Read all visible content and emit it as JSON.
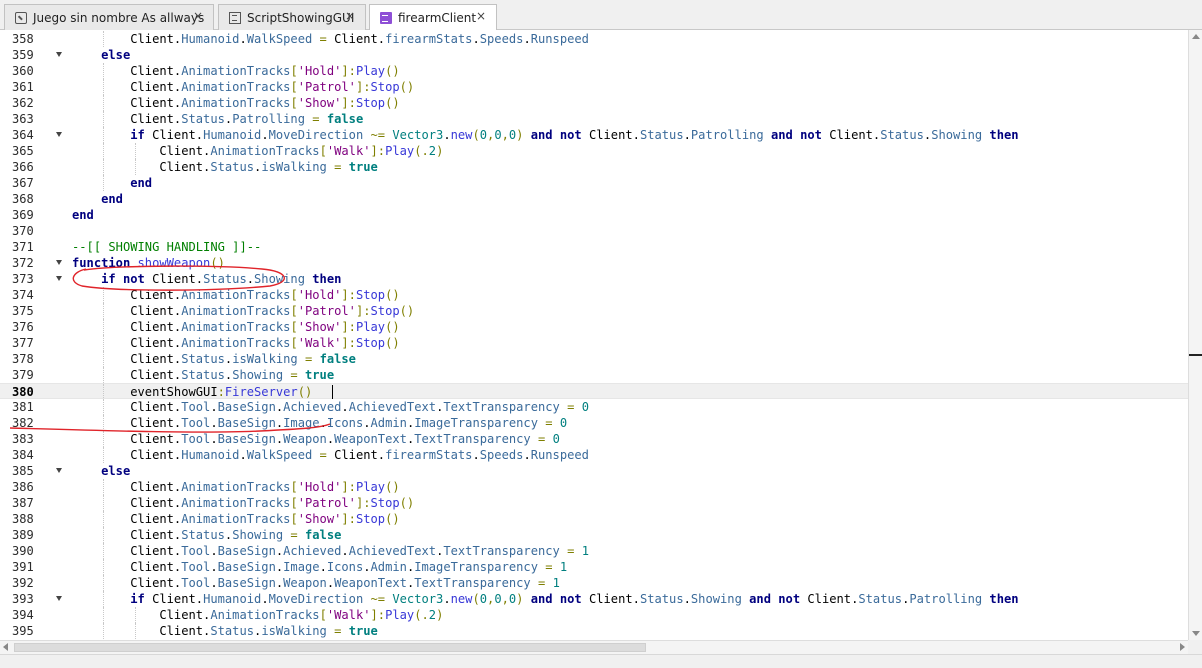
{
  "tabs": [
    {
      "label": "Juego sin nombre As allways",
      "close": "×",
      "icon": "place-icon",
      "active": false
    },
    {
      "label": "ScriptShowingGUI",
      "close": "×",
      "icon": "script-icon",
      "active": false
    },
    {
      "label": "firearmClient",
      "close": "×",
      "icon": "local-script-icon",
      "active": true
    }
  ],
  "current_line": "380",
  "lines": [
    {
      "n": "358",
      "fold": false,
      "t": [
        [
          "df",
          "        Client."
        ],
        [
          "pr",
          "Humanoid"
        ],
        [
          "df",
          "."
        ],
        [
          "pr",
          "WalkSpeed"
        ],
        [
          "op",
          " = "
        ],
        [
          "df",
          "Client."
        ],
        [
          "pr",
          "firearmStats"
        ],
        [
          "df",
          "."
        ],
        [
          "pr",
          "Speeds"
        ],
        [
          "df",
          "."
        ],
        [
          "pr",
          "Runspeed"
        ]
      ]
    },
    {
      "n": "359",
      "fold": true,
      "t": [
        [
          "kw",
          "    else"
        ]
      ]
    },
    {
      "n": "360",
      "fold": false,
      "t": [
        [
          "df",
          "        Client."
        ],
        [
          "pr",
          "AnimationTracks"
        ],
        [
          "op",
          "["
        ],
        [
          "st",
          "'Hold'"
        ],
        [
          "op",
          "]:"
        ],
        [
          "fn",
          "Play"
        ],
        [
          "op",
          "()"
        ]
      ]
    },
    {
      "n": "361",
      "fold": false,
      "t": [
        [
          "df",
          "        Client."
        ],
        [
          "pr",
          "AnimationTracks"
        ],
        [
          "op",
          "["
        ],
        [
          "st",
          "'Patrol'"
        ],
        [
          "op",
          "]:"
        ],
        [
          "fn",
          "Stop"
        ],
        [
          "op",
          "()"
        ]
      ]
    },
    {
      "n": "362",
      "fold": false,
      "t": [
        [
          "df",
          "        Client."
        ],
        [
          "pr",
          "AnimationTracks"
        ],
        [
          "op",
          "["
        ],
        [
          "st",
          "'Show'"
        ],
        [
          "op",
          "]:"
        ],
        [
          "fn",
          "Stop"
        ],
        [
          "op",
          "()"
        ]
      ]
    },
    {
      "n": "363",
      "fold": false,
      "t": [
        [
          "df",
          "        Client."
        ],
        [
          "pr",
          "Status"
        ],
        [
          "df",
          "."
        ],
        [
          "pr",
          "Patrolling"
        ],
        [
          "op",
          " = "
        ],
        [
          "bo",
          "false"
        ]
      ]
    },
    {
      "n": "364",
      "fold": true,
      "t": [
        [
          "kw",
          "        if "
        ],
        [
          "df",
          "Client."
        ],
        [
          "pr",
          "Humanoid"
        ],
        [
          "df",
          "."
        ],
        [
          "pr",
          "MoveDirection"
        ],
        [
          "op",
          " ~= "
        ],
        [
          "gl",
          "Vector3"
        ],
        [
          "df",
          "."
        ],
        [
          "fn",
          "new"
        ],
        [
          "op",
          "("
        ],
        [
          "nm",
          "0"
        ],
        [
          "op",
          ","
        ],
        [
          "nm",
          "0"
        ],
        [
          "op",
          ","
        ],
        [
          "nm",
          "0"
        ],
        [
          "op",
          ") "
        ],
        [
          "kw",
          "and not "
        ],
        [
          "df",
          "Client."
        ],
        [
          "pr",
          "Status"
        ],
        [
          "df",
          "."
        ],
        [
          "pr",
          "Patrolling"
        ],
        [
          "kw",
          " and not "
        ],
        [
          "df",
          "Client."
        ],
        [
          "pr",
          "Status"
        ],
        [
          "df",
          "."
        ],
        [
          "pr",
          "Showing"
        ],
        [
          "kw",
          " then"
        ]
      ]
    },
    {
      "n": "365",
      "fold": false,
      "t": [
        [
          "df",
          "            Client."
        ],
        [
          "pr",
          "AnimationTracks"
        ],
        [
          "op",
          "["
        ],
        [
          "st",
          "'Walk'"
        ],
        [
          "op",
          "]:"
        ],
        [
          "fn",
          "Play"
        ],
        [
          "op",
          "(."
        ],
        [
          "nm",
          "2"
        ],
        [
          "op",
          ")"
        ]
      ]
    },
    {
      "n": "366",
      "fold": false,
      "t": [
        [
          "df",
          "            Client."
        ],
        [
          "pr",
          "Status"
        ],
        [
          "df",
          "."
        ],
        [
          "pr",
          "isWalking"
        ],
        [
          "op",
          " = "
        ],
        [
          "bo",
          "true"
        ]
      ]
    },
    {
      "n": "367",
      "fold": false,
      "t": [
        [
          "kw",
          "        end"
        ]
      ]
    },
    {
      "n": "368",
      "fold": false,
      "t": [
        [
          "kw",
          "    end"
        ]
      ]
    },
    {
      "n": "369",
      "fold": false,
      "t": [
        [
          "kw",
          "end"
        ]
      ]
    },
    {
      "n": "370",
      "fold": false,
      "t": []
    },
    {
      "n": "371",
      "fold": false,
      "t": [
        [
          "cm",
          "--[[ SHOWING HANDLING ]]--"
        ]
      ]
    },
    {
      "n": "372",
      "fold": true,
      "t": [
        [
          "kw",
          "function "
        ],
        [
          "fn",
          "showWeapon"
        ],
        [
          "op",
          "()"
        ]
      ]
    },
    {
      "n": "373",
      "fold": true,
      "t": [
        [
          "kw",
          "    if not "
        ],
        [
          "df",
          "Client."
        ],
        [
          "pr",
          "Status"
        ],
        [
          "df",
          "."
        ],
        [
          "pr",
          "Showing"
        ],
        [
          "kw",
          " then"
        ]
      ]
    },
    {
      "n": "374",
      "fold": false,
      "t": [
        [
          "df",
          "        Client."
        ],
        [
          "pr",
          "AnimationTracks"
        ],
        [
          "op",
          "["
        ],
        [
          "st",
          "'Hold'"
        ],
        [
          "op",
          "]:"
        ],
        [
          "fn",
          "Stop"
        ],
        [
          "op",
          "()"
        ]
      ]
    },
    {
      "n": "375",
      "fold": false,
      "t": [
        [
          "df",
          "        Client."
        ],
        [
          "pr",
          "AnimationTracks"
        ],
        [
          "op",
          "["
        ],
        [
          "st",
          "'Patrol'"
        ],
        [
          "op",
          "]:"
        ],
        [
          "fn",
          "Stop"
        ],
        [
          "op",
          "()"
        ]
      ]
    },
    {
      "n": "376",
      "fold": false,
      "t": [
        [
          "df",
          "        Client."
        ],
        [
          "pr",
          "AnimationTracks"
        ],
        [
          "op",
          "["
        ],
        [
          "st",
          "'Show'"
        ],
        [
          "op",
          "]:"
        ],
        [
          "fn",
          "Play"
        ],
        [
          "op",
          "()"
        ]
      ]
    },
    {
      "n": "377",
      "fold": false,
      "t": [
        [
          "df",
          "        Client."
        ],
        [
          "pr",
          "AnimationTracks"
        ],
        [
          "op",
          "["
        ],
        [
          "st",
          "'Walk'"
        ],
        [
          "op",
          "]:"
        ],
        [
          "fn",
          "Stop"
        ],
        [
          "op",
          "()"
        ]
      ]
    },
    {
      "n": "378",
      "fold": false,
      "t": [
        [
          "df",
          "        Client."
        ],
        [
          "pr",
          "Status"
        ],
        [
          "df",
          "."
        ],
        [
          "pr",
          "isWalking"
        ],
        [
          "op",
          " = "
        ],
        [
          "bo",
          "false"
        ]
      ]
    },
    {
      "n": "379",
      "fold": false,
      "t": [
        [
          "df",
          "        Client."
        ],
        [
          "pr",
          "Status"
        ],
        [
          "df",
          "."
        ],
        [
          "pr",
          "Showing"
        ],
        [
          "op",
          " = "
        ],
        [
          "bo",
          "true"
        ]
      ]
    },
    {
      "n": "380",
      "fold": false,
      "t": [
        [
          "df",
          "        eventShowGUI"
        ],
        [
          "op",
          ":"
        ],
        [
          "fn",
          "FireServer"
        ],
        [
          "op",
          "()"
        ]
      ]
    },
    {
      "n": "381",
      "fold": false,
      "t": [
        [
          "df",
          "        Client."
        ],
        [
          "pr",
          "Tool"
        ],
        [
          "df",
          "."
        ],
        [
          "pr",
          "BaseSign"
        ],
        [
          "df",
          "."
        ],
        [
          "pr",
          "Achieved"
        ],
        [
          "df",
          "."
        ],
        [
          "pr",
          "AchievedText"
        ],
        [
          "df",
          "."
        ],
        [
          "pr",
          "TextTransparency"
        ],
        [
          "op",
          " = "
        ],
        [
          "nm",
          "0"
        ]
      ]
    },
    {
      "n": "382",
      "fold": false,
      "t": [
        [
          "df",
          "        Client."
        ],
        [
          "pr",
          "Tool"
        ],
        [
          "df",
          "."
        ],
        [
          "pr",
          "BaseSign"
        ],
        [
          "df",
          "."
        ],
        [
          "pr",
          "Image"
        ],
        [
          "df",
          "."
        ],
        [
          "pr",
          "Icons"
        ],
        [
          "df",
          "."
        ],
        [
          "pr",
          "Admin"
        ],
        [
          "df",
          "."
        ],
        [
          "pr",
          "ImageTransparency"
        ],
        [
          "op",
          " = "
        ],
        [
          "nm",
          "0"
        ]
      ]
    },
    {
      "n": "383",
      "fold": false,
      "t": [
        [
          "df",
          "        Client."
        ],
        [
          "pr",
          "Tool"
        ],
        [
          "df",
          "."
        ],
        [
          "pr",
          "BaseSign"
        ],
        [
          "df",
          "."
        ],
        [
          "pr",
          "Weapon"
        ],
        [
          "df",
          "."
        ],
        [
          "pr",
          "WeaponText"
        ],
        [
          "df",
          "."
        ],
        [
          "pr",
          "TextTransparency"
        ],
        [
          "op",
          " = "
        ],
        [
          "nm",
          "0"
        ]
      ]
    },
    {
      "n": "384",
      "fold": false,
      "t": [
        [
          "df",
          "        Client."
        ],
        [
          "pr",
          "Humanoid"
        ],
        [
          "df",
          "."
        ],
        [
          "pr",
          "WalkSpeed"
        ],
        [
          "op",
          " = "
        ],
        [
          "df",
          "Client."
        ],
        [
          "pr",
          "firearmStats"
        ],
        [
          "df",
          "."
        ],
        [
          "pr",
          "Speeds"
        ],
        [
          "df",
          "."
        ],
        [
          "pr",
          "Runspeed"
        ]
      ]
    },
    {
      "n": "385",
      "fold": true,
      "t": [
        [
          "kw",
          "    else"
        ]
      ]
    },
    {
      "n": "386",
      "fold": false,
      "t": [
        [
          "df",
          "        Client."
        ],
        [
          "pr",
          "AnimationTracks"
        ],
        [
          "op",
          "["
        ],
        [
          "st",
          "'Hold'"
        ],
        [
          "op",
          "]:"
        ],
        [
          "fn",
          "Play"
        ],
        [
          "op",
          "()"
        ]
      ]
    },
    {
      "n": "387",
      "fold": false,
      "t": [
        [
          "df",
          "        Client."
        ],
        [
          "pr",
          "AnimationTracks"
        ],
        [
          "op",
          "["
        ],
        [
          "st",
          "'Patrol'"
        ],
        [
          "op",
          "]:"
        ],
        [
          "fn",
          "Stop"
        ],
        [
          "op",
          "()"
        ]
      ]
    },
    {
      "n": "388",
      "fold": false,
      "t": [
        [
          "df",
          "        Client."
        ],
        [
          "pr",
          "AnimationTracks"
        ],
        [
          "op",
          "["
        ],
        [
          "st",
          "'Show'"
        ],
        [
          "op",
          "]:"
        ],
        [
          "fn",
          "Stop"
        ],
        [
          "op",
          "()"
        ]
      ]
    },
    {
      "n": "389",
      "fold": false,
      "t": [
        [
          "df",
          "        Client."
        ],
        [
          "pr",
          "Status"
        ],
        [
          "df",
          "."
        ],
        [
          "pr",
          "Showing"
        ],
        [
          "op",
          " = "
        ],
        [
          "bo",
          "false"
        ]
      ]
    },
    {
      "n": "390",
      "fold": false,
      "t": [
        [
          "df",
          "        Client."
        ],
        [
          "pr",
          "Tool"
        ],
        [
          "df",
          "."
        ],
        [
          "pr",
          "BaseSign"
        ],
        [
          "df",
          "."
        ],
        [
          "pr",
          "Achieved"
        ],
        [
          "df",
          "."
        ],
        [
          "pr",
          "AchievedText"
        ],
        [
          "df",
          "."
        ],
        [
          "pr",
          "TextTransparency"
        ],
        [
          "op",
          " = "
        ],
        [
          "nm",
          "1"
        ]
      ]
    },
    {
      "n": "391",
      "fold": false,
      "t": [
        [
          "df",
          "        Client."
        ],
        [
          "pr",
          "Tool"
        ],
        [
          "df",
          "."
        ],
        [
          "pr",
          "BaseSign"
        ],
        [
          "df",
          "."
        ],
        [
          "pr",
          "Image"
        ],
        [
          "df",
          "."
        ],
        [
          "pr",
          "Icons"
        ],
        [
          "df",
          "."
        ],
        [
          "pr",
          "Admin"
        ],
        [
          "df",
          "."
        ],
        [
          "pr",
          "ImageTransparency"
        ],
        [
          "op",
          " = "
        ],
        [
          "nm",
          "1"
        ]
      ]
    },
    {
      "n": "392",
      "fold": false,
      "t": [
        [
          "df",
          "        Client."
        ],
        [
          "pr",
          "Tool"
        ],
        [
          "df",
          "."
        ],
        [
          "pr",
          "BaseSign"
        ],
        [
          "df",
          "."
        ],
        [
          "pr",
          "Weapon"
        ],
        [
          "df",
          "."
        ],
        [
          "pr",
          "WeaponText"
        ],
        [
          "df",
          "."
        ],
        [
          "pr",
          "TextTransparency"
        ],
        [
          "op",
          " = "
        ],
        [
          "nm",
          "1"
        ]
      ]
    },
    {
      "n": "393",
      "fold": true,
      "t": [
        [
          "kw",
          "        if "
        ],
        [
          "df",
          "Client."
        ],
        [
          "pr",
          "Humanoid"
        ],
        [
          "df",
          "."
        ],
        [
          "pr",
          "MoveDirection"
        ],
        [
          "op",
          " ~= "
        ],
        [
          "gl",
          "Vector3"
        ],
        [
          "df",
          "."
        ],
        [
          "fn",
          "new"
        ],
        [
          "op",
          "("
        ],
        [
          "nm",
          "0"
        ],
        [
          "op",
          ","
        ],
        [
          "nm",
          "0"
        ],
        [
          "op",
          ","
        ],
        [
          "nm",
          "0"
        ],
        [
          "op",
          ") "
        ],
        [
          "kw",
          "and not "
        ],
        [
          "df",
          "Client."
        ],
        [
          "pr",
          "Status"
        ],
        [
          "df",
          "."
        ],
        [
          "pr",
          "Showing"
        ],
        [
          "kw",
          " and not "
        ],
        [
          "df",
          "Client."
        ],
        [
          "pr",
          "Status"
        ],
        [
          "df",
          "."
        ],
        [
          "pr",
          "Patrolling"
        ],
        [
          "kw",
          " then"
        ]
      ]
    },
    {
      "n": "394",
      "fold": false,
      "t": [
        [
          "df",
          "            Client."
        ],
        [
          "pr",
          "AnimationTracks"
        ],
        [
          "op",
          "["
        ],
        [
          "st",
          "'Walk'"
        ],
        [
          "op",
          "]:"
        ],
        [
          "fn",
          "Play"
        ],
        [
          "op",
          "(."
        ],
        [
          "nm",
          "2"
        ],
        [
          "op",
          ")"
        ]
      ]
    },
    {
      "n": "395",
      "fold": false,
      "t": [
        [
          "df",
          "            Client."
        ],
        [
          "pr",
          "Status"
        ],
        [
          "df",
          "."
        ],
        [
          "pr",
          "isWalking"
        ],
        [
          "op",
          " = "
        ],
        [
          "bo",
          "true"
        ]
      ]
    }
  ],
  "colors": {
    "keyword": "#00007f",
    "boolean": "#007f7f",
    "function": "#3737d7",
    "string": "#7f007f",
    "comment": "#007f00",
    "annotation": "#e0242a"
  }
}
